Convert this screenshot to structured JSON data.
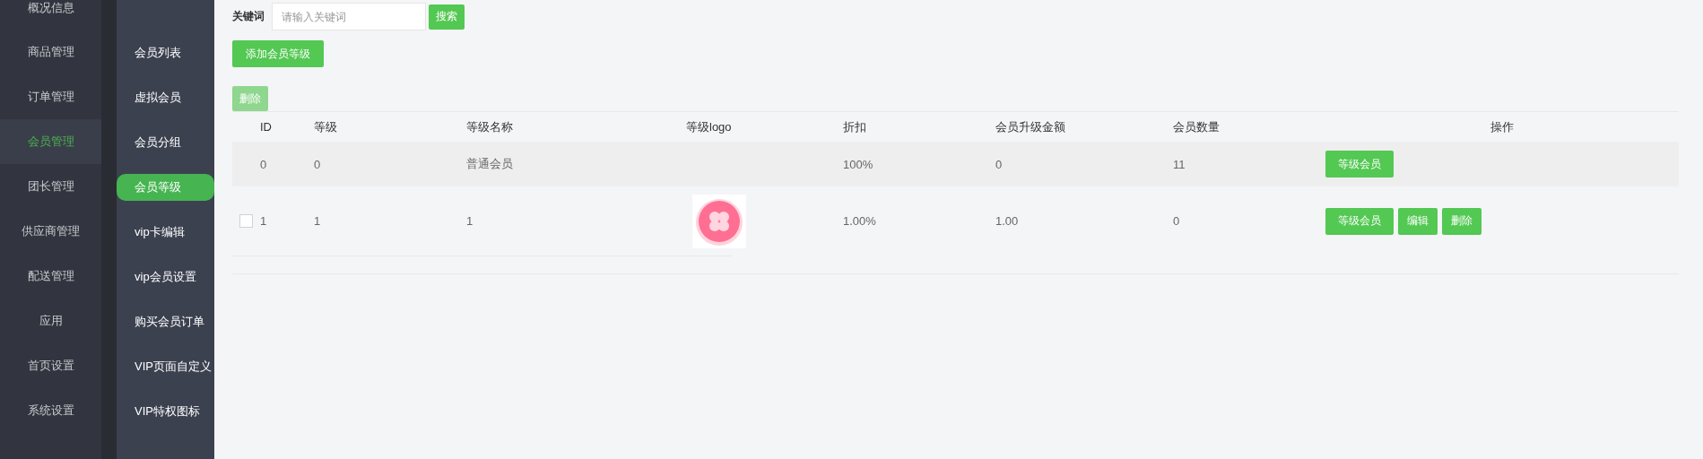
{
  "nav": [
    {
      "label": "概况信息",
      "selected": false
    },
    {
      "label": "商品管理",
      "selected": false
    },
    {
      "label": "订单管理",
      "selected": false
    },
    {
      "label": "会员管理",
      "selected": true
    },
    {
      "label": "团长管理",
      "selected": false
    },
    {
      "label": "供应商管理",
      "selected": false
    },
    {
      "label": "配送管理",
      "selected": false
    },
    {
      "label": "应用",
      "selected": false
    },
    {
      "label": "首页设置",
      "selected": false
    },
    {
      "label": "系统设置",
      "selected": false
    }
  ],
  "subnav": [
    {
      "label": "会员列表",
      "selected": false
    },
    {
      "label": "虚拟会员",
      "selected": false
    },
    {
      "label": "会员分组",
      "selected": false
    },
    {
      "label": "会员等级",
      "selected": true
    },
    {
      "label": "vip卡编辑",
      "selected": false
    },
    {
      "label": "vip会员设置",
      "selected": false
    },
    {
      "label": "购买会员订单",
      "selected": false
    },
    {
      "label": "VIP页面自定义",
      "selected": false
    },
    {
      "label": "VIP特权图标",
      "selected": false
    }
  ],
  "search": {
    "label": "关键词",
    "placeholder": "请输入关键词",
    "button": "搜索"
  },
  "add_button": "添加会员等级",
  "bulk_delete": {
    "label": "删除",
    "disabled": true
  },
  "table": {
    "columns": [
      "ID",
      "等级",
      "等级名称",
      "等级logo",
      "折扣",
      "会员升级金额",
      "会员数量",
      "操作"
    ],
    "rows": [
      {
        "cells": [
          "0",
          "0",
          "普通会员",
          "",
          "100%",
          "0",
          "11"
        ],
        "actions": [
          "等级会员"
        ]
      },
      {
        "checked": false,
        "cells": [
          "1",
          "1",
          "1",
          "",
          "1.00%",
          "1.00",
          "0"
        ],
        "logo": {
          "kind": "picture"
        },
        "actions": [
          "等级会员",
          "编辑",
          "删除"
        ]
      }
    ]
  }
}
